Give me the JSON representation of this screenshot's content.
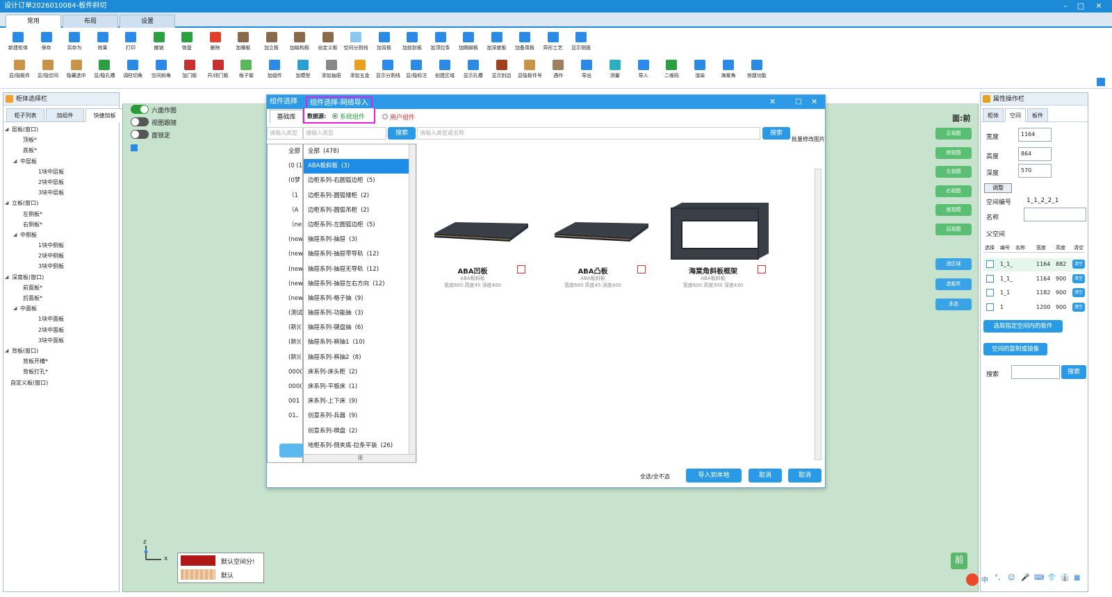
{
  "window": {
    "title": "设计订单2026010084-板件斜切",
    "controls": [
      "–",
      "□",
      "✕"
    ]
  },
  "ribbon_tabs": [
    "常用",
    "布局",
    "设置"
  ],
  "toolbar_row1": [
    {
      "label": "新建柜体",
      "icon": "new-cabinet-icon",
      "color": "#2a8ae6"
    },
    {
      "label": "保存",
      "icon": "save-icon",
      "color": "#2a8ae6"
    },
    {
      "label": "另存为",
      "icon": "save-as-icon",
      "color": "#2a8ae6"
    },
    {
      "label": "效果",
      "icon": "render-icon",
      "color": "#2a8ae6"
    },
    {
      "label": "打印",
      "icon": "print-icon",
      "color": "#2a8ae6"
    },
    {
      "label": "撤销",
      "icon": "undo-icon",
      "color": "#2aa040"
    },
    {
      "label": "恢复",
      "icon": "redo-icon",
      "color": "#2aa040"
    },
    {
      "label": "删除",
      "icon": "delete-icon",
      "color": "#e2402a"
    },
    {
      "label": "加横板",
      "icon": "add-horizontal-board-icon",
      "color": "#8a6a4a"
    },
    {
      "label": "加立板",
      "icon": "add-vertical-board-icon",
      "color": "#8a6a4a"
    },
    {
      "label": "加结构板",
      "icon": "add-structure-board-icon",
      "color": "#8a6a4a"
    },
    {
      "label": "自定义板",
      "icon": "custom-board-icon",
      "color": "#8a6a4a"
    },
    {
      "label": "空间分割线",
      "icon": "space-divider-icon",
      "color": "#8ac8f0"
    },
    {
      "label": "加背板",
      "icon": "add-back-board-icon",
      "color": "#2a8ae6"
    },
    {
      "label": "加前封板",
      "icon": "add-front-seal-icon",
      "color": "#2a8ae6"
    },
    {
      "label": "加顶拉条",
      "icon": "add-top-strip-icon",
      "color": "#2a8ae6"
    },
    {
      "label": "加踢脚板",
      "icon": "add-kickboard-icon",
      "color": "#2a8ae6"
    },
    {
      "label": "加深度板",
      "icon": "add-depth-board-icon",
      "color": "#2a8ae6"
    },
    {
      "label": "加备用板",
      "icon": "add-spare-board-icon",
      "color": "#2a8ae6"
    },
    {
      "label": "异形工艺",
      "icon": "special-craft-icon",
      "color": "#2a8ae6"
    },
    {
      "label": "显示侧面",
      "icon": "show-side-icon",
      "color": "#2a8ae6"
    }
  ],
  "toolbar_row2": [
    {
      "label": "显/隐板件",
      "icon": "toggle-board-icon",
      "color": "#c8944a"
    },
    {
      "label": "显/隐空间",
      "icon": "toggle-space-icon",
      "color": "#c8944a"
    },
    {
      "label": "隐藏选中",
      "icon": "hide-selected-icon",
      "color": "#c8944a"
    },
    {
      "label": "显/隐孔槽",
      "icon": "toggle-holes-icon",
      "color": "#2aa040"
    },
    {
      "label": "调柱切角",
      "icon": "column-cut-icon",
      "color": "#2a8ae6"
    },
    {
      "label": "空间斜角",
      "icon": "space-bevel-icon",
      "color": "#2a8ae6"
    },
    {
      "label": "加门板",
      "icon": "add-door-icon",
      "color": "#c83030"
    },
    {
      "label": "开/闭门板",
      "icon": "open-close-door-icon",
      "color": "#c83030"
    },
    {
      "label": "格子架",
      "icon": "grid-rack-icon",
      "color": "#5ab85a"
    },
    {
      "label": "加组件",
      "icon": "add-component-icon",
      "color": "#2a8ae6"
    },
    {
      "label": "加模型",
      "icon": "add-model-icon",
      "color": "#2aa0d0"
    },
    {
      "label": "添加抽屉",
      "icon": "add-drawer-icon",
      "color": "#888888"
    },
    {
      "label": "添加五金",
      "icon": "add-hardware-icon",
      "color": "#e8a020"
    },
    {
      "label": "显示分割线",
      "icon": "show-divider-icon",
      "color": "#2a8ae6"
    },
    {
      "label": "显/隐标注",
      "icon": "toggle-dimension-icon",
      "color": "#2a8ae6"
    },
    {
      "label": "创建区域",
      "icon": "create-area-icon",
      "color": "#2a8ae6"
    },
    {
      "label": "显示孔槽",
      "icon": "show-holes-icon",
      "color": "#2a8ae6"
    },
    {
      "label": "显示封边",
      "icon": "show-edge-icon",
      "color": "#a04020"
    },
    {
      "label": "显隐板件号",
      "icon": "toggle-board-number-icon",
      "color": "#c8944a"
    },
    {
      "label": "遇作",
      "icon": "operation-icon",
      "color": "#a08060"
    },
    {
      "label": "导出",
      "icon": "export-icon",
      "color": "#2a8ae6"
    },
    {
      "label": "测量",
      "icon": "measure-icon",
      "color": "#2ab0c0"
    },
    {
      "label": "导入",
      "icon": "import-icon",
      "color": "#2a8ae6"
    },
    {
      "label": "二维码",
      "icon": "qrcode-icon",
      "color": "#2aa040"
    },
    {
      "label": "渲染",
      "icon": "render2-icon",
      "color": "#2a8ae6"
    },
    {
      "label": "海棠角",
      "icon": "corner-icon",
      "color": "#2a8ae6"
    },
    {
      "label": "快捷功能",
      "icon": "quick-function-icon",
      "color": "#2a8ae6"
    }
  ],
  "left_panel": {
    "title": "柜体选择栏",
    "tabs": [
      "柜子列表",
      "加组件",
      "快捷加板"
    ],
    "tree": [
      {
        "label": "层板(窗口)",
        "level": 0,
        "exp": "◢"
      },
      {
        "label": "顶板*",
        "level": 2,
        "exp": ""
      },
      {
        "label": "底板*",
        "level": 2,
        "exp": ""
      },
      {
        "label": "中层板",
        "level": 1,
        "exp": "◢"
      },
      {
        "label": "1块中层板",
        "level": 3,
        "exp": ""
      },
      {
        "label": "2块中层板",
        "level": 3,
        "exp": ""
      },
      {
        "label": "3块中层板",
        "level": 3,
        "exp": ""
      },
      {
        "label": "立板(窗口)",
        "level": 0,
        "exp": "◢"
      },
      {
        "label": "左侧板*",
        "level": 2,
        "exp": ""
      },
      {
        "label": "右侧板*",
        "level": 2,
        "exp": ""
      },
      {
        "label": "中侧板",
        "level": 1,
        "exp": "◢"
      },
      {
        "label": "1块中侧板",
        "level": 3,
        "exp": ""
      },
      {
        "label": "2块中侧板",
        "level": 3,
        "exp": ""
      },
      {
        "label": "3块中侧板",
        "level": 3,
        "exp": ""
      },
      {
        "label": "深度板(窗口)",
        "level": 0,
        "exp": "◢"
      },
      {
        "label": "前面板*",
        "level": 2,
        "exp": ""
      },
      {
        "label": "后面板*",
        "level": 2,
        "exp": ""
      },
      {
        "label": "中面板",
        "level": 1,
        "exp": "◢"
      },
      {
        "label": "1块中面板",
        "level": 3,
        "exp": ""
      },
      {
        "label": "2块中面板",
        "level": 3,
        "exp": ""
      },
      {
        "label": "3块中面板",
        "level": 3,
        "exp": ""
      },
      {
        "label": "背板(窗口)",
        "level": 0,
        "exp": "◢"
      },
      {
        "label": "背板开槽*",
        "level": 2,
        "exp": ""
      },
      {
        "label": "背板打孔*",
        "level": 2,
        "exp": ""
      },
      {
        "label": "自定义板(窗口)",
        "level": 0,
        "exp": ""
      }
    ]
  },
  "canvas": {
    "toggles": [
      {
        "label": "六面作图",
        "on": true
      },
      {
        "label": "视图跟随",
        "on": false
      },
      {
        "label": "面锁定",
        "on": false
      }
    ],
    "face_label": "面:前",
    "view_buttons": [
      "正视图",
      "俯视图",
      "左视图",
      "右视图",
      "底视图",
      "后视图"
    ],
    "select_buttons": [
      "选区域",
      "选板件",
      "多选"
    ],
    "legend": [
      {
        "label": "默认空间分!",
        "color": "#b01818"
      },
      {
        "label": "默认",
        "color": "#e8b888"
      }
    ],
    "axis": {
      "z": "z",
      "x": "x"
    },
    "front_badge": "前"
  },
  "dialog": {
    "title": "组件选择",
    "tab_highlight": "组件选择-网络导入",
    "datasource_label": "数据源:",
    "ds_system": "系统组件",
    "ds_user": "用户组件",
    "left_tab": "基础库",
    "search_left_placeholder": "请输入类型",
    "search_mid_placeholder": "请输入类型",
    "search_btn": "搜索",
    "search_right_placeholder": "请输入类型或名称",
    "search_btn2": "搜索",
    "modify_img": "批量修改图片",
    "bg_tree": [
      "全部",
      "(0 (1",
      "(0梦",
      "（1",
      "（A",
      "（ne",
      "(new",
      "(new",
      "(new",
      "(new",
      "(new",
      "(测试",
      "(新)(",
      "(新)(",
      "(新)(",
      "000(",
      "000(",
      "001",
      "01、"
    ],
    "categories": [
      {
        "label": "全部",
        "count": "(478)"
      },
      {
        "label": "ABA板斜板",
        "count": "(3)"
      },
      {
        "label": "边柜系列-右圆弧边柜",
        "count": "(5)"
      },
      {
        "label": "边柜系列-圆弧矮柜",
        "count": "(2)"
      },
      {
        "label": "边柜系列-圆弧吊柜",
        "count": "(2)"
      },
      {
        "label": "边柜系列-左圆弧边柜",
        "count": "(5)"
      },
      {
        "label": "抽屉系列-抽屉",
        "count": "(3)"
      },
      {
        "label": "抽屉系列-抽屉带导轨",
        "count": "(12)"
      },
      {
        "label": "抽屉系列-抽屉无导轨",
        "count": "(12)"
      },
      {
        "label": "抽屉系列-抽屉左右方向",
        "count": "(12)"
      },
      {
        "label": "抽屉系列-格子抽",
        "count": "(9)"
      },
      {
        "label": "抽屉系列-功能抽",
        "count": "(3)"
      },
      {
        "label": "抽屉系列-键盘抽",
        "count": "(6)"
      },
      {
        "label": "抽屉系列-裤抽1",
        "count": "(10)"
      },
      {
        "label": "抽屉系列-裤抽2",
        "count": "(8)"
      },
      {
        "label": "床系列-床头柜",
        "count": "(2)"
      },
      {
        "label": "床系列-平板床",
        "count": "(1)"
      },
      {
        "label": "床系列-上下床",
        "count": "(9)"
      },
      {
        "label": "创意系列-兵器",
        "count": "(9)"
      },
      {
        "label": "创意系列-棋盘",
        "count": "(2)"
      },
      {
        "label": "地柜系列-侧夹底-拉条平装",
        "count": "(26)"
      }
    ],
    "selected_index": 1,
    "items": [
      {
        "name": "ABA凹板",
        "sub": "ABA板斜板",
        "dims": "宽度600 高度45 深度400",
        "shape": "slab"
      },
      {
        "name": "ABA凸板",
        "sub": "ABA板斜板",
        "dims": "宽度600 高度45 深度400",
        "shape": "slab"
      },
      {
        "name": "海棠角斜板框架",
        "sub": "ABA板斜板",
        "dims": "宽度600 高度300 深度430",
        "shape": "frame"
      }
    ],
    "select_all": "全选/全不选",
    "import_btn": "导入到本地",
    "cancel_btn": "取消",
    "cancel_btn2": "取消",
    "hscroll_mark": "|||"
  },
  "right_panel": {
    "title": "属性操作栏",
    "tabs": [
      "柜体",
      "空间",
      "板件"
    ],
    "width_label": "宽度",
    "width_value": "1164",
    "height_label": "高度",
    "height_value": "864",
    "depth_label": "深度",
    "depth_value": "570",
    "adjust_btn": "调整",
    "space_no_label": "空间编号",
    "space_no_value": "1_1_2_2_1",
    "name_label": "名称",
    "name_value": "",
    "parent_label": "父空间",
    "grid_headers": [
      "选择",
      "编号",
      "名称",
      "宽度",
      "高度",
      "清空"
    ],
    "grid_rows": [
      {
        "no": "1_1_",
        "w": "1164",
        "h": "882",
        "btn": "清空"
      },
      {
        "no": "1_1_",
        "w": "1164",
        "h": "900",
        "btn": "清空"
      },
      {
        "no": "1_1",
        "w": "1182",
        "h": "900",
        "btn": "清空"
      },
      {
        "no": "1",
        "w": "1200",
        "h": "900",
        "btn": "清空"
      }
    ],
    "btn_select_boards": "选取指定空间内的板件",
    "btn_copy_mirror": "空间的复制或镜像",
    "search_label": "搜索",
    "search_btn": "搜索"
  },
  "tray": [
    "中",
    "°,",
    "☺",
    "🎤",
    "⌨",
    "👕",
    "👔",
    "▦"
  ]
}
